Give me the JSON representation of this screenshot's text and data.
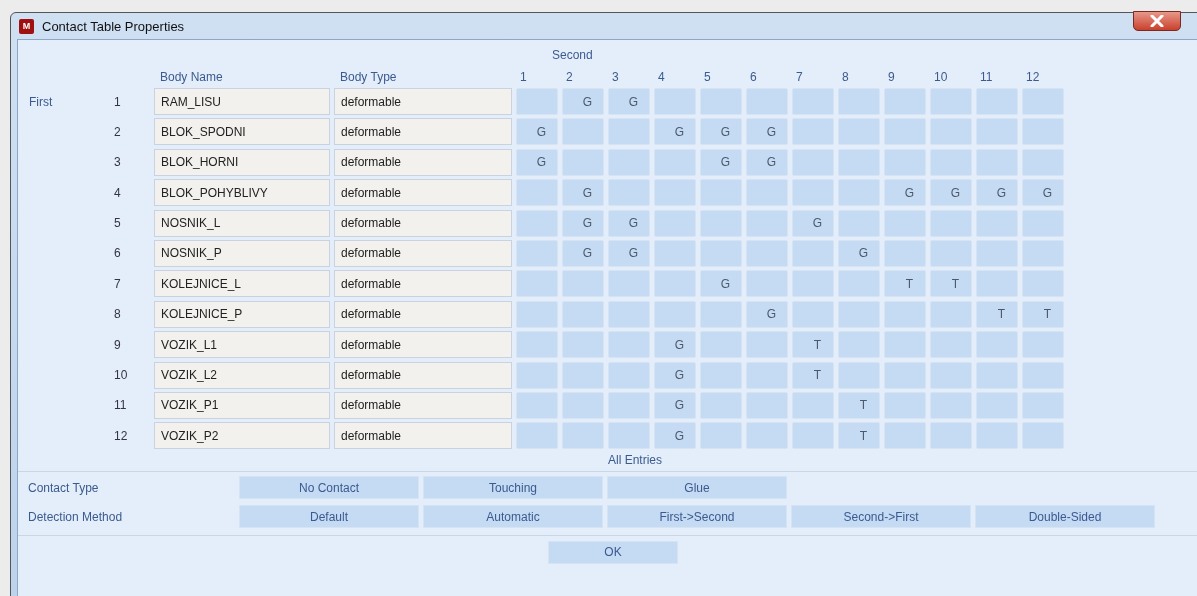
{
  "window": {
    "title": "Contact Table Properties",
    "app_icon_letter": "M"
  },
  "table": {
    "second_label": "Second",
    "first_label": "First",
    "columns": [
      "Body Name",
      "Body Type"
    ],
    "column_numbers": [
      "1",
      "2",
      "3",
      "4",
      "5",
      "6",
      "7",
      "8",
      "9",
      "10",
      "11",
      "12"
    ],
    "rows": [
      {
        "number": "1",
        "name": "RAM_LISU",
        "type": "deformable",
        "cells": [
          null,
          "G",
          "G",
          null,
          null,
          null,
          null,
          null,
          null,
          null,
          null,
          null
        ]
      },
      {
        "number": "2",
        "name": "BLOK_SPODNI",
        "type": "deformable",
        "cells": [
          "G",
          null,
          null,
          "G",
          "G",
          "G",
          null,
          null,
          null,
          null,
          null,
          null
        ]
      },
      {
        "number": "3",
        "name": "BLOK_HORNI",
        "type": "deformable",
        "cells": [
          "G",
          null,
          null,
          null,
          "G",
          "G",
          null,
          null,
          null,
          null,
          null,
          null
        ]
      },
      {
        "number": "4",
        "name": "BLOK_POHYBLIVY",
        "type": "deformable",
        "cells": [
          null,
          "G",
          null,
          null,
          null,
          null,
          null,
          null,
          "G",
          "G",
          "G",
          "G"
        ]
      },
      {
        "number": "5",
        "name": "NOSNIK_L",
        "type": "deformable",
        "cells": [
          null,
          "G",
          "G",
          null,
          null,
          null,
          "G",
          null,
          null,
          null,
          null,
          null
        ]
      },
      {
        "number": "6",
        "name": "NOSNIK_P",
        "type": "deformable",
        "cells": [
          null,
          "G",
          "G",
          null,
          null,
          null,
          null,
          "G",
          null,
          null,
          null,
          null
        ]
      },
      {
        "number": "7",
        "name": "KOLEJNICE_L",
        "type": "deformable",
        "cells": [
          null,
          null,
          null,
          null,
          "G",
          null,
          null,
          null,
          "T",
          "T",
          null,
          null
        ]
      },
      {
        "number": "8",
        "name": "KOLEJNICE_P",
        "type": "deformable",
        "cells": [
          null,
          null,
          null,
          null,
          null,
          "G",
          null,
          null,
          null,
          null,
          "T",
          "T"
        ]
      },
      {
        "number": "9",
        "name": "VOZIK_L1",
        "type": "deformable",
        "cells": [
          null,
          null,
          null,
          "G",
          null,
          null,
          "T",
          null,
          null,
          null,
          null,
          null
        ]
      },
      {
        "number": "10",
        "name": "VOZIK_L2",
        "type": "deformable",
        "cells": [
          null,
          null,
          null,
          "G",
          null,
          null,
          "T",
          null,
          null,
          null,
          null,
          null
        ]
      },
      {
        "number": "11",
        "name": "VOZIK_P1",
        "type": "deformable",
        "cells": [
          null,
          null,
          null,
          "G",
          null,
          null,
          null,
          "T",
          null,
          null,
          null,
          null
        ]
      },
      {
        "number": "12",
        "name": "VOZIK_P2",
        "type": "deformable",
        "cells": [
          null,
          null,
          null,
          "G",
          null,
          null,
          null,
          "T",
          null,
          null,
          null,
          null
        ]
      }
    ]
  },
  "all_entries": {
    "title": "All Entries",
    "groups": [
      {
        "label": "Contact Type",
        "buttons": [
          "No Contact",
          "Touching",
          "Glue"
        ]
      },
      {
        "label": "Detection Method",
        "buttons": [
          "Default",
          "Automatic",
          "First->Second",
          "Second->First",
          "Double-Sided"
        ]
      }
    ]
  },
  "ok_button": "OK"
}
